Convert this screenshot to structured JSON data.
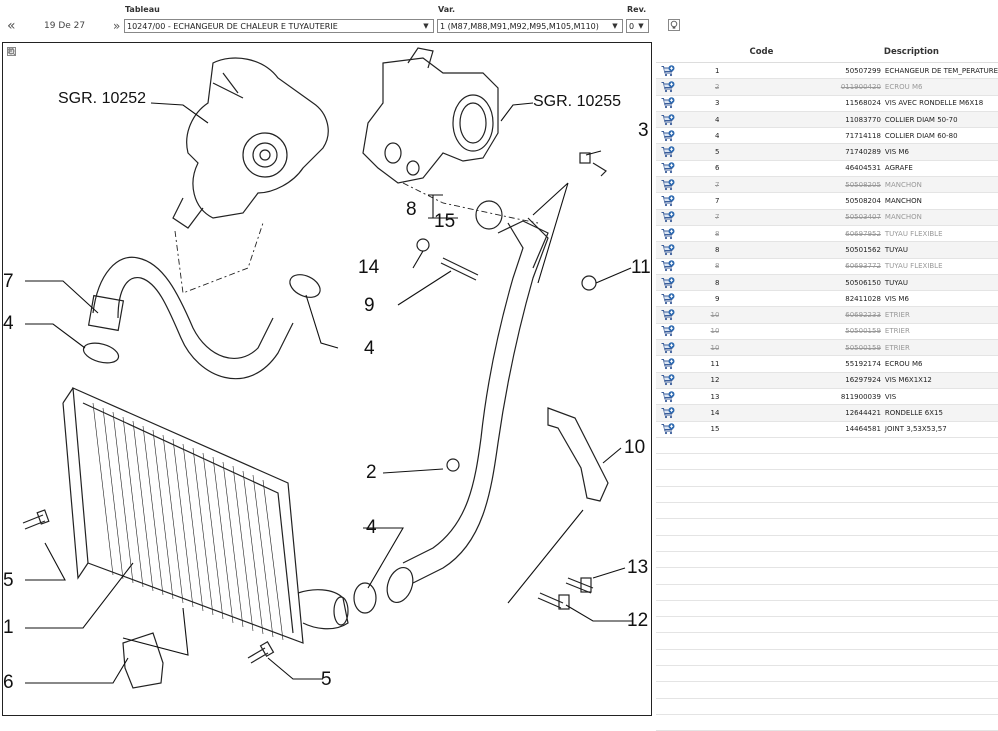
{
  "nav": {
    "prev": "«",
    "next": "»",
    "pager": "19 De 27"
  },
  "filters": {
    "tableau_label": "Tableau",
    "tableau_value": "10247/00 - ECHANGEUR DE CHALEUR E TUYAUTERIE",
    "var_label": "Var.",
    "var_value": "1 (M87,M88,M91,M92,M95,M105,M110)",
    "rev_label": "Rev.",
    "rev_value": "0"
  },
  "icons": {
    "bulb": "lightbulb-icon",
    "cart": "add-to-cart-icon",
    "zoom": [
      "zoom-fit-icon",
      "zoom-in-icon",
      "zoom-out-icon"
    ]
  },
  "drawing": {
    "sgr_left": "SGR. 10252",
    "sgr_right": "SGR. 10255",
    "callouts": [
      "7",
      "4",
      "5",
      "1",
      "6",
      "3",
      "8",
      "15",
      "14",
      "9",
      "11",
      "4",
      "2",
      "10",
      "4",
      "13",
      "12",
      "5"
    ]
  },
  "table": {
    "headers": {
      "code": "Code",
      "description": "Description"
    },
    "rows": [
      {
        "ref": "1",
        "code": "50507299",
        "desc": "ECHANGEUR DE TEM_PERATURE",
        "struck": false
      },
      {
        "ref": "2",
        "code": "011900420",
        "desc": "ECROU M6",
        "struck": true
      },
      {
        "ref": "3",
        "code": "11568024",
        "desc": "VIS AVEC RONDELLE M6X18",
        "struck": false
      },
      {
        "ref": "4",
        "code": "11083770",
        "desc": "COLLIER DIAM 50-70",
        "struck": false
      },
      {
        "ref": "4",
        "code": "71714118",
        "desc": "COLLIER DIAM 60-80",
        "struck": false
      },
      {
        "ref": "5",
        "code": "71740289",
        "desc": "VIS M6",
        "struck": false
      },
      {
        "ref": "6",
        "code": "46404531",
        "desc": "AGRAFE",
        "struck": false
      },
      {
        "ref": "7",
        "code": "50508205",
        "desc": "MANCHON",
        "struck": true
      },
      {
        "ref": "7",
        "code": "50508204",
        "desc": "MANCHON",
        "struck": false
      },
      {
        "ref": "7",
        "code": "50503407",
        "desc": "MANCHON",
        "struck": true
      },
      {
        "ref": "8",
        "code": "60697952",
        "desc": "TUYAU FLEXIBLE",
        "struck": true
      },
      {
        "ref": "8",
        "code": "50501562",
        "desc": "TUYAU",
        "struck": false
      },
      {
        "ref": "8",
        "code": "60693772",
        "desc": "TUYAU FLEXIBLE",
        "struck": true
      },
      {
        "ref": "8",
        "code": "50506150",
        "desc": "TUYAU",
        "struck": false
      },
      {
        "ref": "9",
        "code": "82411028",
        "desc": "VIS M6",
        "struck": false
      },
      {
        "ref": "10",
        "code": "60692233",
        "desc": "ETRIER",
        "struck": true
      },
      {
        "ref": "10",
        "code": "50500159",
        "desc": "ETRIER",
        "struck": true
      },
      {
        "ref": "10",
        "code": "50500159",
        "desc": "ETRIER",
        "struck": true
      },
      {
        "ref": "11",
        "code": "55192174",
        "desc": "ECROU M6",
        "struck": false
      },
      {
        "ref": "12",
        "code": "16297924",
        "desc": "VIS M6X1X12",
        "struck": false
      },
      {
        "ref": "13",
        "code": "811900039",
        "desc": "VIS",
        "struck": false
      },
      {
        "ref": "14",
        "code": "12644421",
        "desc": "RONDELLE 6X15",
        "struck": false
      },
      {
        "ref": "15",
        "code": "14464581",
        "desc": "JOINT 3,53X53,57",
        "struck": false
      }
    ]
  }
}
